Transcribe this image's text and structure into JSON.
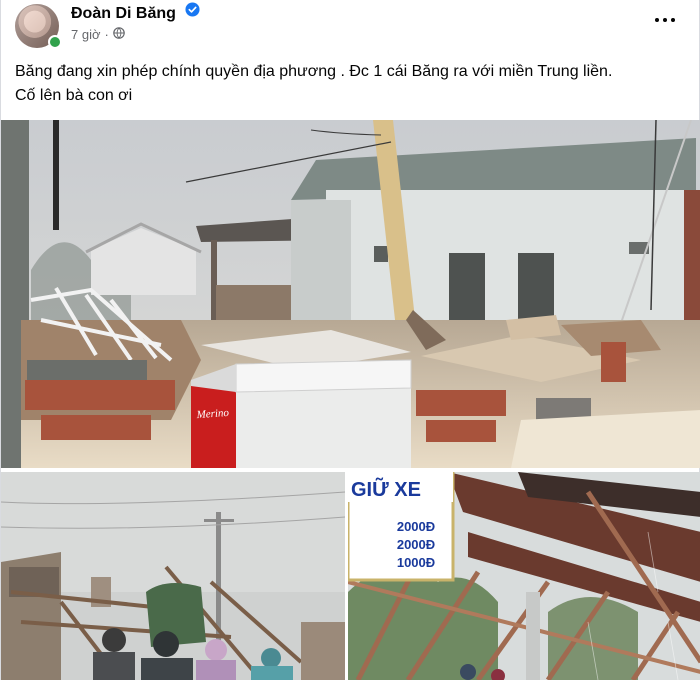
{
  "post": {
    "author": "Đoàn Di Băng",
    "time": "7 giờ",
    "separator": "·",
    "caption_line1": "Băng đang xin phép chính quyền địa phương . Đc 1 cái Băng ra với miền Trung liền.",
    "caption_line2": "Cố lên bà con ơi"
  },
  "photos": {
    "main": {
      "fridge_label": "Merino"
    },
    "right": {
      "sign_title": "GIỮ XE",
      "sign_line1": "2000Đ",
      "sign_line2": "2000Đ",
      "sign_line3": "1000Đ"
    }
  },
  "colors": {
    "verified": "#1877f2",
    "online": "#31a24c",
    "meta": "#65676b",
    "sign_text": "#1a3a9c"
  },
  "icons": [
    "verified-badge-icon",
    "globe-icon",
    "more-options-icon"
  ]
}
